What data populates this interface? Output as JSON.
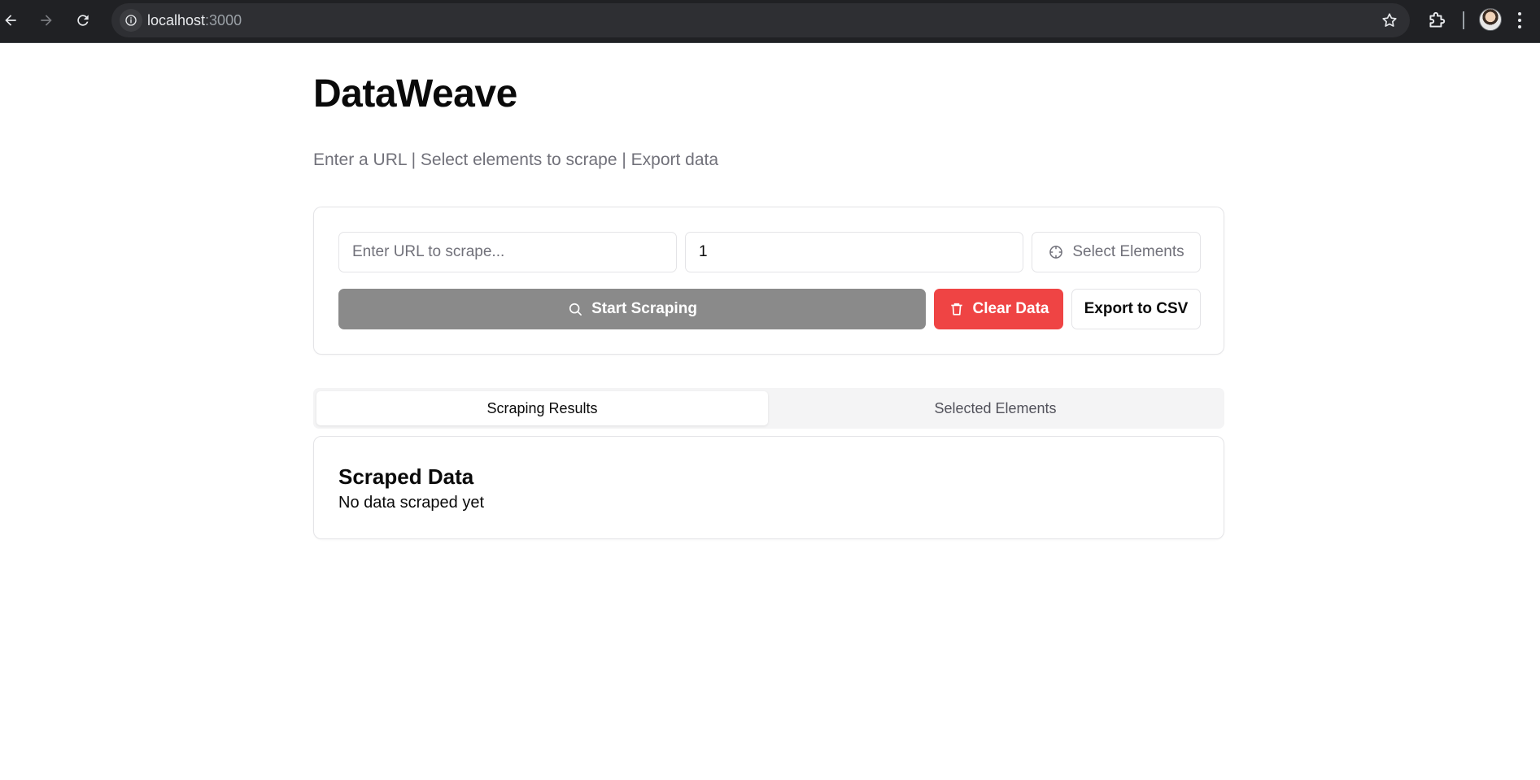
{
  "browser": {
    "url_host": "localhost",
    "url_port": ":3000"
  },
  "app": {
    "title": "DataWeave",
    "subtitle": "Enter a URL | Select elements to scrape | Export data"
  },
  "controls": {
    "url_placeholder": "Enter URL to scrape...",
    "url_value": "",
    "pages_value": "1",
    "select_elements_label": "Select Elements",
    "start_label": "Start Scraping",
    "clear_label": "Clear Data",
    "export_label": "Export to CSV",
    "colors": {
      "start_bg": "#8a8a8a",
      "clear_bg": "#ef4444"
    }
  },
  "tabs": [
    {
      "label": "Scraping Results",
      "active": true
    },
    {
      "label": "Selected Elements",
      "active": false
    }
  ],
  "results": {
    "heading": "Scraped Data",
    "empty_message": "No data scraped yet"
  }
}
